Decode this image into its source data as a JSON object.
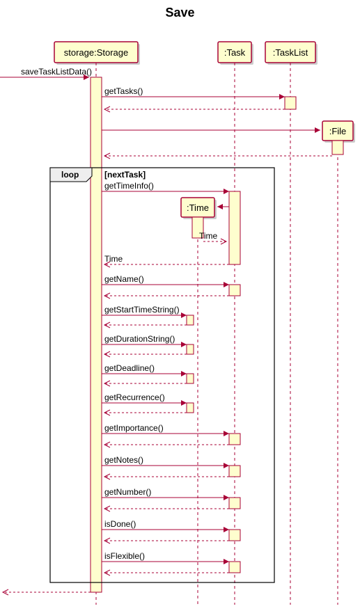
{
  "title": "Save",
  "participants": {
    "storage": "storage:Storage",
    "task": ":Task",
    "tasklist": ":TaskList",
    "file": ":File",
    "time": ":Time"
  },
  "loop": {
    "keyword": "loop",
    "condition": "[nextTask]"
  },
  "messages": {
    "m0": "saveTaskListData()",
    "m1": "getTasks()",
    "m2": "getTimeInfo()",
    "m3": "Time",
    "m4": "Time",
    "m5": "getName()",
    "m6": "getStartTimeString()",
    "m7": "getDurationString()",
    "m8": "getDeadline()",
    "m9": "getRecurrence()",
    "m10": "getImportance()",
    "m11": "getNotes()",
    "m12": "getNumber()",
    "m13": "isDone()",
    "m14": "isFlexible()"
  },
  "chart_data": {
    "type": "sequence-diagram",
    "title": "Save",
    "participants": [
      "storage:Storage",
      ":Task",
      ":TaskList",
      ":File",
      ":Time"
    ],
    "fragments": [
      {
        "type": "message",
        "from": "external",
        "to": "storage:Storage",
        "label": "saveTaskListData()",
        "style": "sync"
      },
      {
        "type": "message",
        "from": "storage:Storage",
        "to": ":TaskList",
        "label": "getTasks()",
        "style": "sync"
      },
      {
        "type": "return",
        "from": ":TaskList",
        "to": "storage:Storage"
      },
      {
        "type": "create",
        "from": "storage:Storage",
        "to": ":File"
      },
      {
        "type": "return",
        "from": ":File",
        "to": "storage:Storage"
      },
      {
        "type": "loop",
        "condition": "[nextTask]",
        "body": [
          {
            "type": "message",
            "from": "storage:Storage",
            "to": ":Task",
            "label": "getTimeInfo()",
            "style": "sync"
          },
          {
            "type": "create",
            "from": ":Task",
            "to": ":Time"
          },
          {
            "type": "return",
            "from": ":Time",
            "to": ":Task",
            "label": "Time"
          },
          {
            "type": "return",
            "from": ":Task",
            "to": "storage:Storage",
            "label": "Time"
          },
          {
            "type": "message",
            "from": "storage:Storage",
            "to": ":Task",
            "label": "getName()",
            "style": "sync"
          },
          {
            "type": "return",
            "from": ":Task",
            "to": "storage:Storage"
          },
          {
            "type": "message",
            "from": "storage:Storage",
            "to": "self",
            "label": "getStartTimeString()",
            "style": "sync"
          },
          {
            "type": "message",
            "from": "storage:Storage",
            "to": "self",
            "label": "getDurationString()",
            "style": "sync"
          },
          {
            "type": "message",
            "from": "storage:Storage",
            "to": "self",
            "label": "getDeadline()",
            "style": "sync"
          },
          {
            "type": "message",
            "from": "storage:Storage",
            "to": "self",
            "label": "getRecurrence()",
            "style": "sync"
          },
          {
            "type": "message",
            "from": "storage:Storage",
            "to": ":Task",
            "label": "getImportance()",
            "style": "sync"
          },
          {
            "type": "return",
            "from": ":Task",
            "to": "storage:Storage"
          },
          {
            "type": "message",
            "from": "storage:Storage",
            "to": ":Task",
            "label": "getNotes()",
            "style": "sync"
          },
          {
            "type": "return",
            "from": ":Task",
            "to": "storage:Storage"
          },
          {
            "type": "message",
            "from": "storage:Storage",
            "to": ":Task",
            "label": "getNumber()",
            "style": "sync"
          },
          {
            "type": "return",
            "from": ":Task",
            "to": "storage:Storage"
          },
          {
            "type": "message",
            "from": "storage:Storage",
            "to": ":Task",
            "label": "isDone()",
            "style": "sync"
          },
          {
            "type": "return",
            "from": ":Task",
            "to": "storage:Storage"
          },
          {
            "type": "message",
            "from": "storage:Storage",
            "to": ":Task",
            "label": "isFlexible()",
            "style": "sync"
          },
          {
            "type": "return",
            "from": ":Task",
            "to": "storage:Storage"
          }
        ]
      },
      {
        "type": "return",
        "from": "storage:Storage",
        "to": "external"
      }
    ]
  }
}
